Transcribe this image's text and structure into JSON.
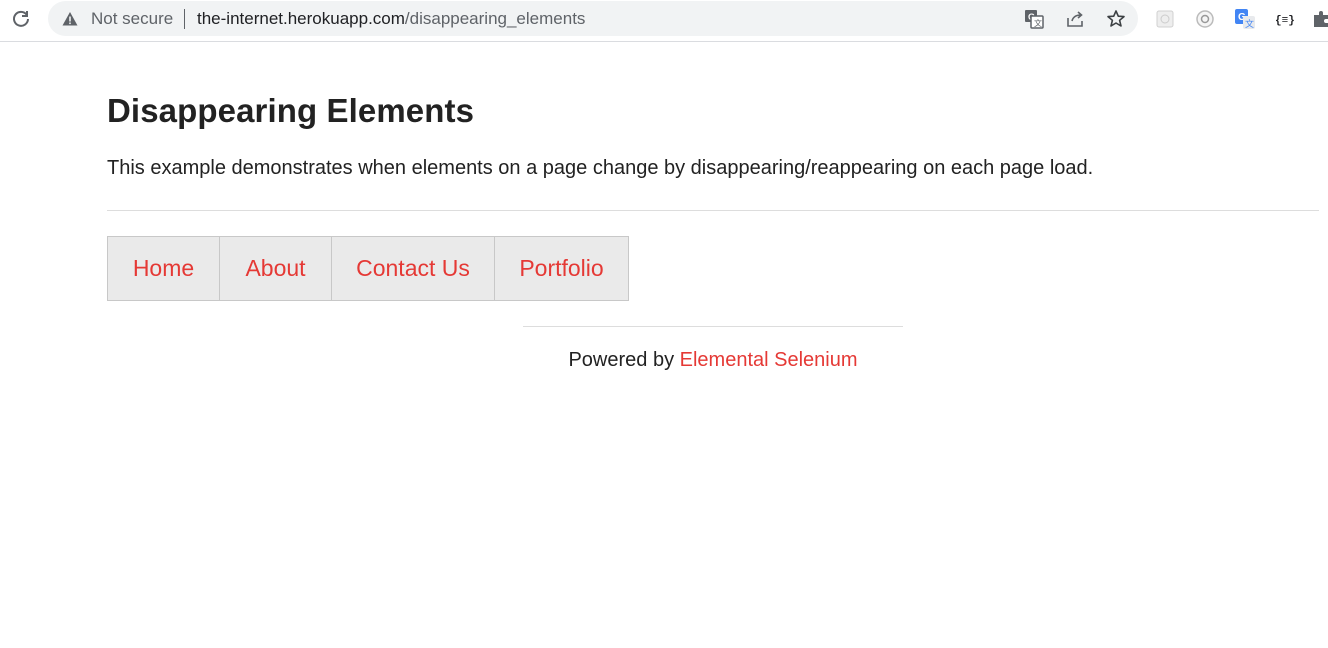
{
  "browser": {
    "security_label": "Not secure",
    "url_host": "the-internet.herokuapp.com",
    "url_path": "/disappearing_elements"
  },
  "page": {
    "title": "Disappearing Elements",
    "description": "This example demonstrates when elements on a page change by disappearing/reappearing on each page load.",
    "menu": [
      {
        "label": "Home"
      },
      {
        "label": "About"
      },
      {
        "label": "Contact Us"
      },
      {
        "label": "Portfolio"
      }
    ],
    "footer": {
      "prefix": "Powered by ",
      "link_label": "Elemental Selenium"
    }
  },
  "colors": {
    "link": "#e53935",
    "menu_bg": "#eaeaea",
    "text": "#222222"
  },
  "icons": {
    "reload": "reload-icon",
    "warning": "warning-icon",
    "translate": "translate-icon",
    "share": "share-icon",
    "bookmark": "star-icon",
    "extensions": [
      "ext-gray-icon",
      "ext-eye-icon",
      "google-translate-icon",
      "json-icon",
      "puzzle-icon"
    ]
  }
}
